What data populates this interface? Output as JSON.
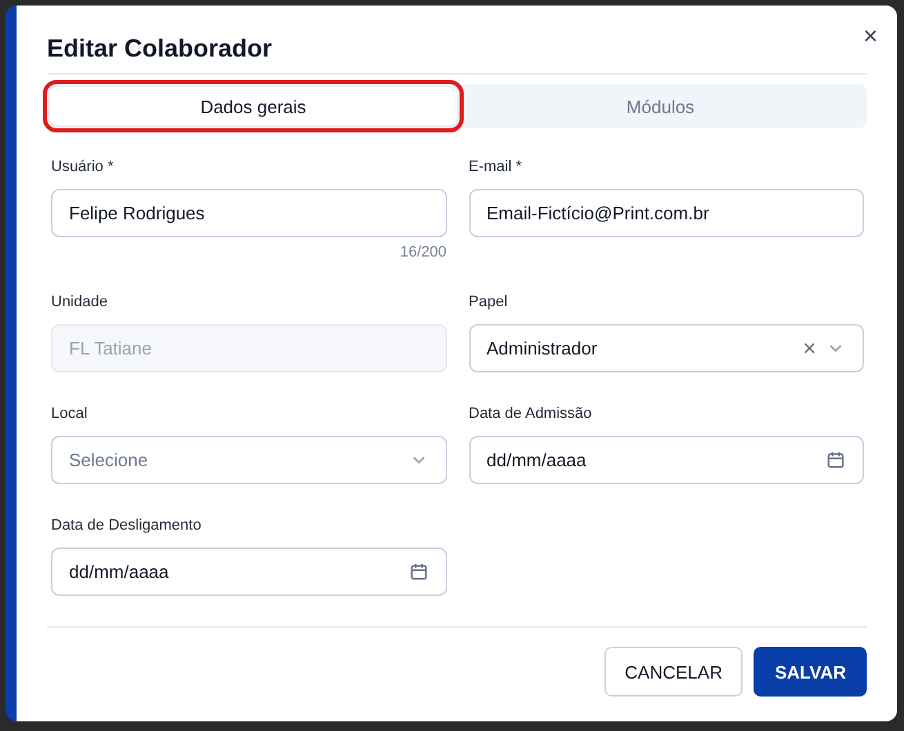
{
  "dialog": {
    "title": "Editar Colaborador",
    "close": "×"
  },
  "tabs": [
    {
      "label": "Dados gerais",
      "selected": true,
      "highlighted": true
    },
    {
      "label": "Módulos",
      "selected": false,
      "highlighted": false
    }
  ],
  "fields": [
    {
      "kind": "text",
      "label": "Usuário *",
      "value": "Felipe Rodrigues",
      "counter": "16/200",
      "disabled": false
    },
    {
      "kind": "text",
      "label": "E-mail *",
      "value": "Email-Fictício@Print.com.br",
      "disabled": false
    },
    {
      "kind": "text",
      "label": "Unidade",
      "value": "FL Tatiane",
      "disabled": true
    },
    {
      "kind": "select",
      "label": "Papel",
      "value": "Administrador",
      "clearable": true
    },
    {
      "kind": "select",
      "label": "Local",
      "placeholder": "Selecione",
      "clearable": false
    },
    {
      "kind": "date",
      "label": "Data de Admissão",
      "placeholder": "dd/mm/aaaa"
    },
    {
      "kind": "date",
      "label": "Data de Desligamento",
      "placeholder": "dd/mm/aaaa"
    }
  ],
  "buttons": [
    {
      "label": "CANCELAR",
      "kind": "secondary"
    },
    {
      "label": "SALVAR",
      "kind": "primary"
    }
  ]
}
